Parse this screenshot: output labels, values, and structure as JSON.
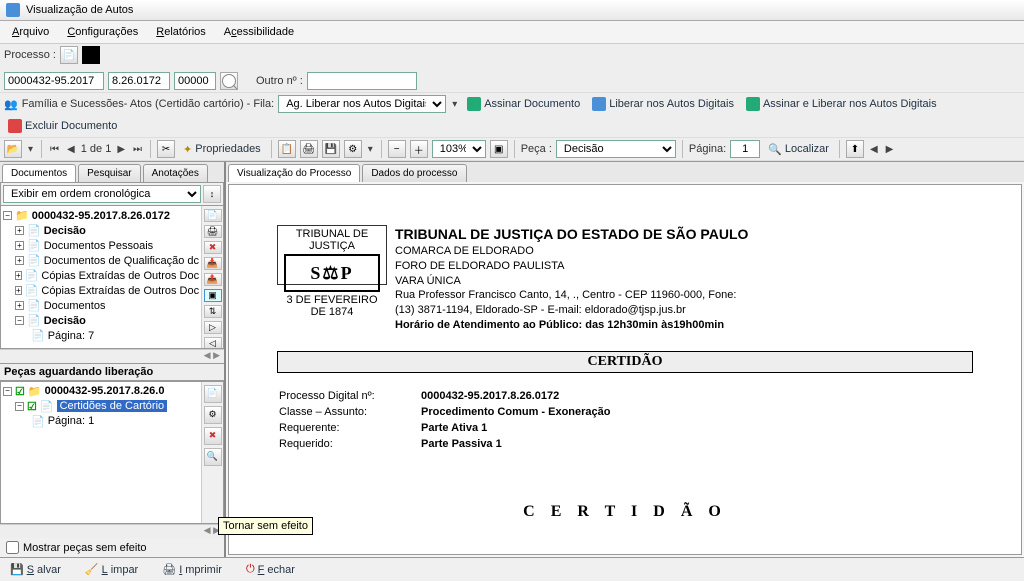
{
  "window": {
    "title": "Visualização de Autos"
  },
  "menu": {
    "arquivo": "Arquivo",
    "config": "Configurações",
    "relatorios": "Relatórios",
    "acess": "Acessibilidade"
  },
  "procRow": {
    "label": "Processo :",
    "num1": "0000432-95.2017",
    "num2": "8.26.0172",
    "num3": "00000",
    "outroLabel": "Outro nº :",
    "outroVal": ""
  },
  "queueRow": {
    "text": "Família e Sucessões- Atos (Certidão cartório) - Fila:",
    "fila": "Ag. Liberar nos Autos Digitais",
    "assinar": "Assinar Documento",
    "liberar": "Liberar nos Autos Digitais",
    "assLib": "Assinar e Liberar nos Autos Digitais",
    "excluir": "Excluir Documento"
  },
  "toolbar": {
    "open": "📂",
    "pageOf": "1 de 1",
    "props": "Propriedades",
    "zoom": "103%",
    "pecaLabel": "Peça :",
    "pecaSel": "Decisão",
    "paginaLabel": "Página:",
    "paginaVal": "1",
    "localizar": "Localizar"
  },
  "leftTabs": {
    "doc": "Documentos",
    "pesq": "Pesquisar",
    "anot": "Anotações"
  },
  "sortSel": "Exibir em ordem cronológica",
  "tree": {
    "root": "0000432-95.2017.8.26.0172",
    "items": [
      "Decisão",
      "Documentos Pessoais",
      "Documentos de Qualificação dc",
      "Cópias Extraídas de Outros Doc",
      "Cópias Extraídas de Outros Doc",
      "Documentos",
      "Decisão"
    ],
    "leaf": "Página: 7"
  },
  "pending": {
    "header": "Peças aguardando liberação",
    "root": "0000432-95.2017.8.26.0",
    "sel": "Certidões de Cartório",
    "leaf": "Página: 1",
    "showEmpty": "Mostrar peças sem efeito"
  },
  "rightTabs": {
    "vis": "Visualização do Processo",
    "dados": "Dados do processo"
  },
  "doc": {
    "logoTop": "TRIBUNAL DE JUSTIÇA",
    "logoMid": "S⚖P",
    "logoBot": "3 DE FEVEREIRO DE 1874",
    "h1": "TRIBUNAL DE JUSTIÇA DO ESTADO DE SÃO PAULO",
    "h2": "COMARCA DE ELDORADO",
    "h3": "FORO DE ELDORADO PAULISTA",
    "h4": "VARA ÚNICA",
    "addr1": "Rua Professor Francisco Canto, 14, ., Centro - CEP 11960-000, Fone:",
    "addr2": "(13) 3871-1194, Eldorado-SP - E-mail: eldorado@tjsp.jus.br",
    "hor": "Horário de Atendimento ao Público: das 12h30min às19h00min",
    "certTitle": "CERTIDÃO",
    "f1l": "Processo Digital nº:",
    "f1v": "0000432-95.2017.8.26.0172",
    "f2l": "Classe – Assunto:",
    "f2v": "Procedimento Comum - Exoneração",
    "f3l": "Requerente:",
    "f3v": "Parte Ativa 1",
    "f4l": "Requerido:",
    "f4v": "Parte Passiva 1",
    "bigCert": "C E R T I D Ã O"
  },
  "tooltip": "Tornar sem efeito",
  "footer": {
    "salvar": "Salvar",
    "limpar": "Limpar",
    "imprimir": "Imprimir",
    "fechar": "Fechar"
  }
}
